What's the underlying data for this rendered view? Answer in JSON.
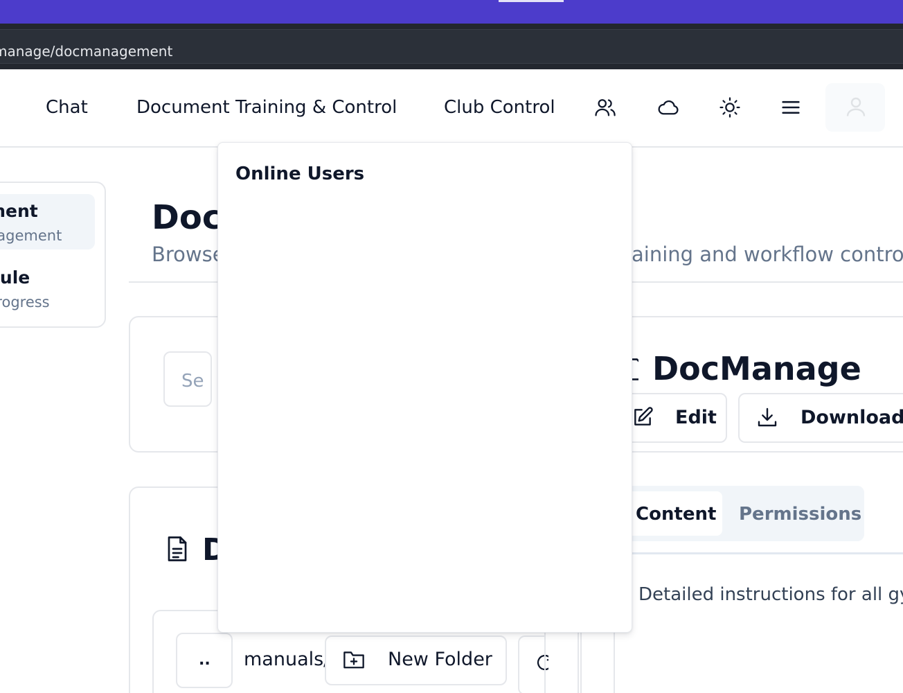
{
  "browser": {
    "url": "manage/docmanagement"
  },
  "nav": {
    "links": [
      "Chat",
      "Document Training & Control",
      "Club Control"
    ],
    "icons": [
      "users-icon",
      "cloud-icon",
      "sun-icon",
      "menu-icon"
    ]
  },
  "sidebar": {
    "items": [
      {
        "title": "ment",
        "subtitle": "nagement",
        "active": true
      },
      {
        "title": "dule",
        "subtitle": "Progress",
        "active": false
      }
    ]
  },
  "page": {
    "title": "Docu",
    "subtitle": "Browse",
    "subtitle_right": "aining and workflow contro"
  },
  "search": {
    "placeholder": "Se"
  },
  "documents": {
    "heading": "D",
    "up_button": "..",
    "path": "manuals/",
    "new_folder": "New Folder"
  },
  "preview": {
    "title": "DocManage",
    "edit": "Edit",
    "download": "Download",
    "tabs": [
      "Content",
      "Permissions"
    ],
    "active_tab": "Content",
    "description": "Detailed instructions for all gym"
  },
  "popover": {
    "title": "Online Users"
  }
}
